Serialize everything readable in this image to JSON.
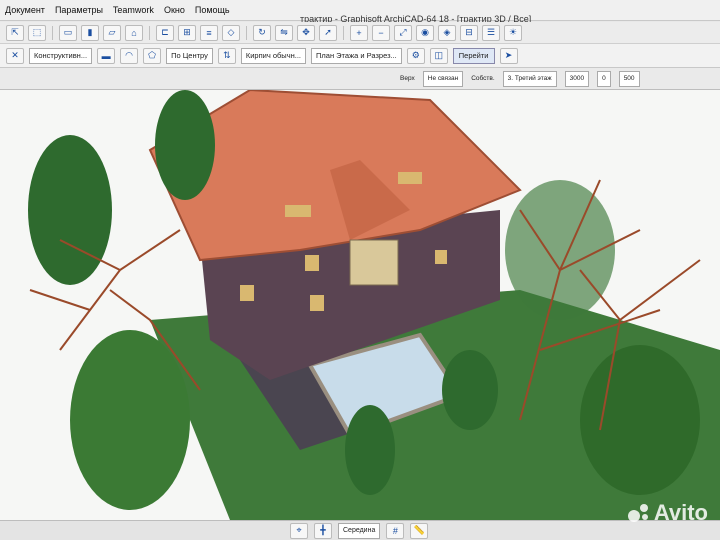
{
  "menu": {
    "items": [
      "Документ",
      "Параметры",
      "Teamwork",
      "Окно",
      "Помощь"
    ]
  },
  "window": {
    "title": "трактир - Graphisoft ArchiCAD-64 18 - [трактир 3D / Все]"
  },
  "toolbar": {
    "layer_label": "Конструктивн...",
    "anchor_label": "По Центру",
    "material_label": "Кирпич обычн...",
    "view_label": "План Этажа и Разрез...",
    "show_label": "Перейти"
  },
  "infobox": {
    "top_label": "Верх",
    "top_value": "Не связан",
    "own_label": "Собств.",
    "floor_value": "3. Третий этаж",
    "height_value": "3000",
    "offset_value": "0",
    "thickness_value": "500"
  },
  "statusbar": {
    "mode_label": "Середина"
  },
  "watermark": {
    "text": "Avito"
  },
  "colors": {
    "roof": "#d97a5a",
    "wall": "#5a4452",
    "pool": "#bfd6e6",
    "grass": "#3f7a3a",
    "tree": "#2e6a2e"
  }
}
